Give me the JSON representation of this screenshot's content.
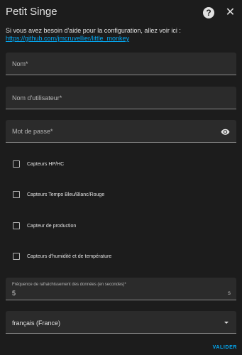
{
  "dialog": {
    "title": "Petit Singe",
    "help_icon": "help-circle-icon",
    "close_icon": "close-icon",
    "help_text": "Si vous avez besoin d'aide pour la configuration, allez voir ici :",
    "help_link": "https://github.com/jmcruvellier/little_monkey"
  },
  "fields": {
    "name_label": "Nom*",
    "username_label": "Nom d'utilisateur*",
    "password_label": "Mot de passe*",
    "password_icon": "eye-icon"
  },
  "checkboxes": [
    {
      "label": "Capteurs HP/HC",
      "checked": false
    },
    {
      "label": "Capteurs Tempo Bleu/Blanc/Rouge",
      "checked": false
    },
    {
      "label": "Capteur de production",
      "checked": false
    },
    {
      "label": "Capteurs d'humidité et de température",
      "checked": false
    }
  ],
  "refresh": {
    "label": "Fréquence de rafraichissement des données (en secondes)*",
    "value": "5",
    "suffix": "s"
  },
  "language": {
    "value": "français (France)",
    "icon": "chevron-down-icon"
  },
  "actions": {
    "submit_label": "VALIDER"
  },
  "colors": {
    "accent": "#03a9f4",
    "background": "#1c1c1c",
    "field": "#2b2b2b"
  }
}
